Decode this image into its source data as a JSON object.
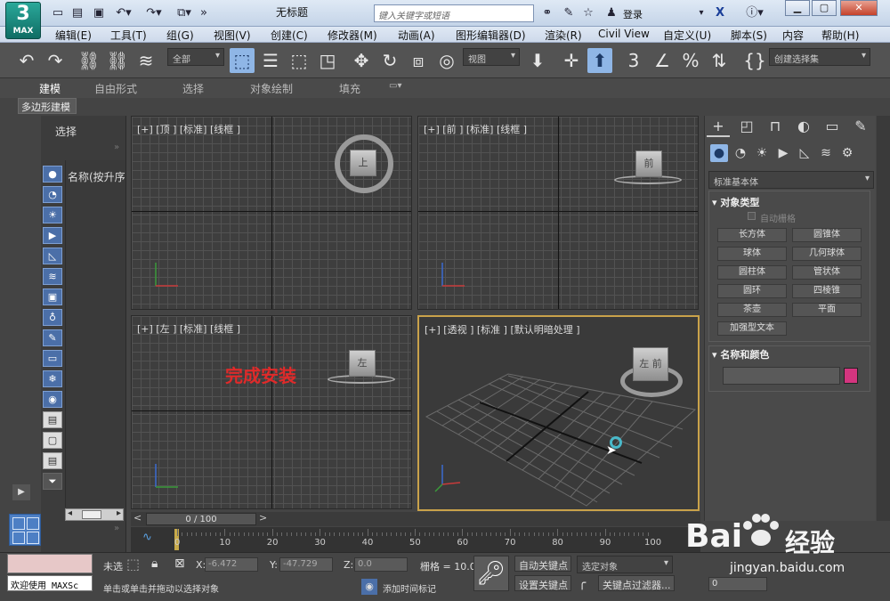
{
  "app": {
    "logo_number": "3",
    "logo_text": "MAX",
    "document_title": "无标题",
    "search_placeholder": "键入关键字或短语",
    "login_label": "登录"
  },
  "menus": [
    "编辑(E)",
    "工具(T)",
    "组(G)",
    "视图(V)",
    "创建(C)",
    "修改器(M)",
    "动画(A)",
    "图形编辑器(D)",
    "渲染(R)",
    "Civil View",
    "自定义(U)",
    "脚本(S)",
    "内容",
    "帮助(H)"
  ],
  "toolbar": {
    "filter_dropdown": "全部",
    "refcoord_dropdown": "视图",
    "selection_set_dropdown": "创建选择集"
  },
  "ribbon": {
    "tabs": [
      "建模",
      "自由形式",
      "选择",
      "对象绘制",
      "填充"
    ],
    "active_tab": "建模",
    "sub_label": "多边形建模"
  },
  "scene_explorer": {
    "select_label": "选择",
    "name_column": "名称(按升序"
  },
  "viewports": {
    "top": {
      "label": "[+] [顶 ] [标准] [线框 ]",
      "cube": "上"
    },
    "front": {
      "label": "[+] [前 ] [标准] [线框 ]",
      "cube": "前"
    },
    "left": {
      "label": "[+] [左 ] [标准] [线框 ]",
      "cube": "左"
    },
    "perspective": {
      "label": "[+] [透视 ] [标准 ] [默认明暗处理 ]",
      "cube": "左 前"
    }
  },
  "overlay_text": "完成安装",
  "command_panel": {
    "category_dropdown": "标准基本体",
    "object_type_header": "对象类型",
    "autogrid_label": "自动栅格",
    "object_buttons": [
      "长方体",
      "圆锥体",
      "球体",
      "几何球体",
      "圆柱体",
      "管状体",
      "圆环",
      "四棱锥",
      "茶壶",
      "平面",
      "加强型文本"
    ],
    "name_color_header": "名称和颜色",
    "color_swatch": "#d4357f"
  },
  "timeline": {
    "frame_label": "0 / 100",
    "ticks": [
      "0",
      "10",
      "20",
      "30",
      "40",
      "50",
      "60",
      "70",
      "80",
      "90",
      "100"
    ]
  },
  "status": {
    "maxscript_text": "欢迎使用 MAXSc",
    "selection_status": "未选",
    "prompt": "单击或单击并拖动以选择对象",
    "x_label": "X:",
    "x_value": "-6.472",
    "y_label": "Y:",
    "y_value": "-47.729",
    "z_label": "Z:",
    "z_value": "0.0",
    "grid_label": "栅格 = 10.0",
    "add_time_tag": "添加时间标记",
    "auto_key": "自动关键点",
    "set_key": "设置关键点",
    "selected_object": "选定对象",
    "key_filters": "关键点过滤器...",
    "frame_field": "0"
  },
  "watermark": {
    "brand": "Bai",
    "brand_cn": "经验",
    "url": "jingyan.baidu.com"
  }
}
